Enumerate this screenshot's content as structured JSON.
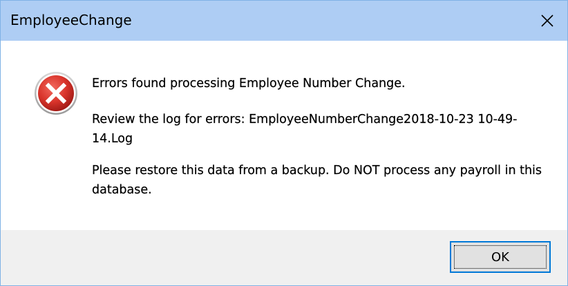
{
  "window": {
    "title": "EmployeeChange",
    "close_icon": "close-icon"
  },
  "message": {
    "icon": "error-icon",
    "line1": "Errors found processing Employee Number Change.",
    "line2": "Review the log for errors: EmployeeNumberChange2018-10-23 10-49-14.Log",
    "line3": "Please restore this data from a backup. Do NOT process any payroll in this database."
  },
  "buttons": {
    "ok_label": "OK"
  },
  "colors": {
    "titlebar": "#aecdf4",
    "footer": "#f0f0f0",
    "button_border": "#0078d7",
    "error_red": "#d9342b"
  }
}
